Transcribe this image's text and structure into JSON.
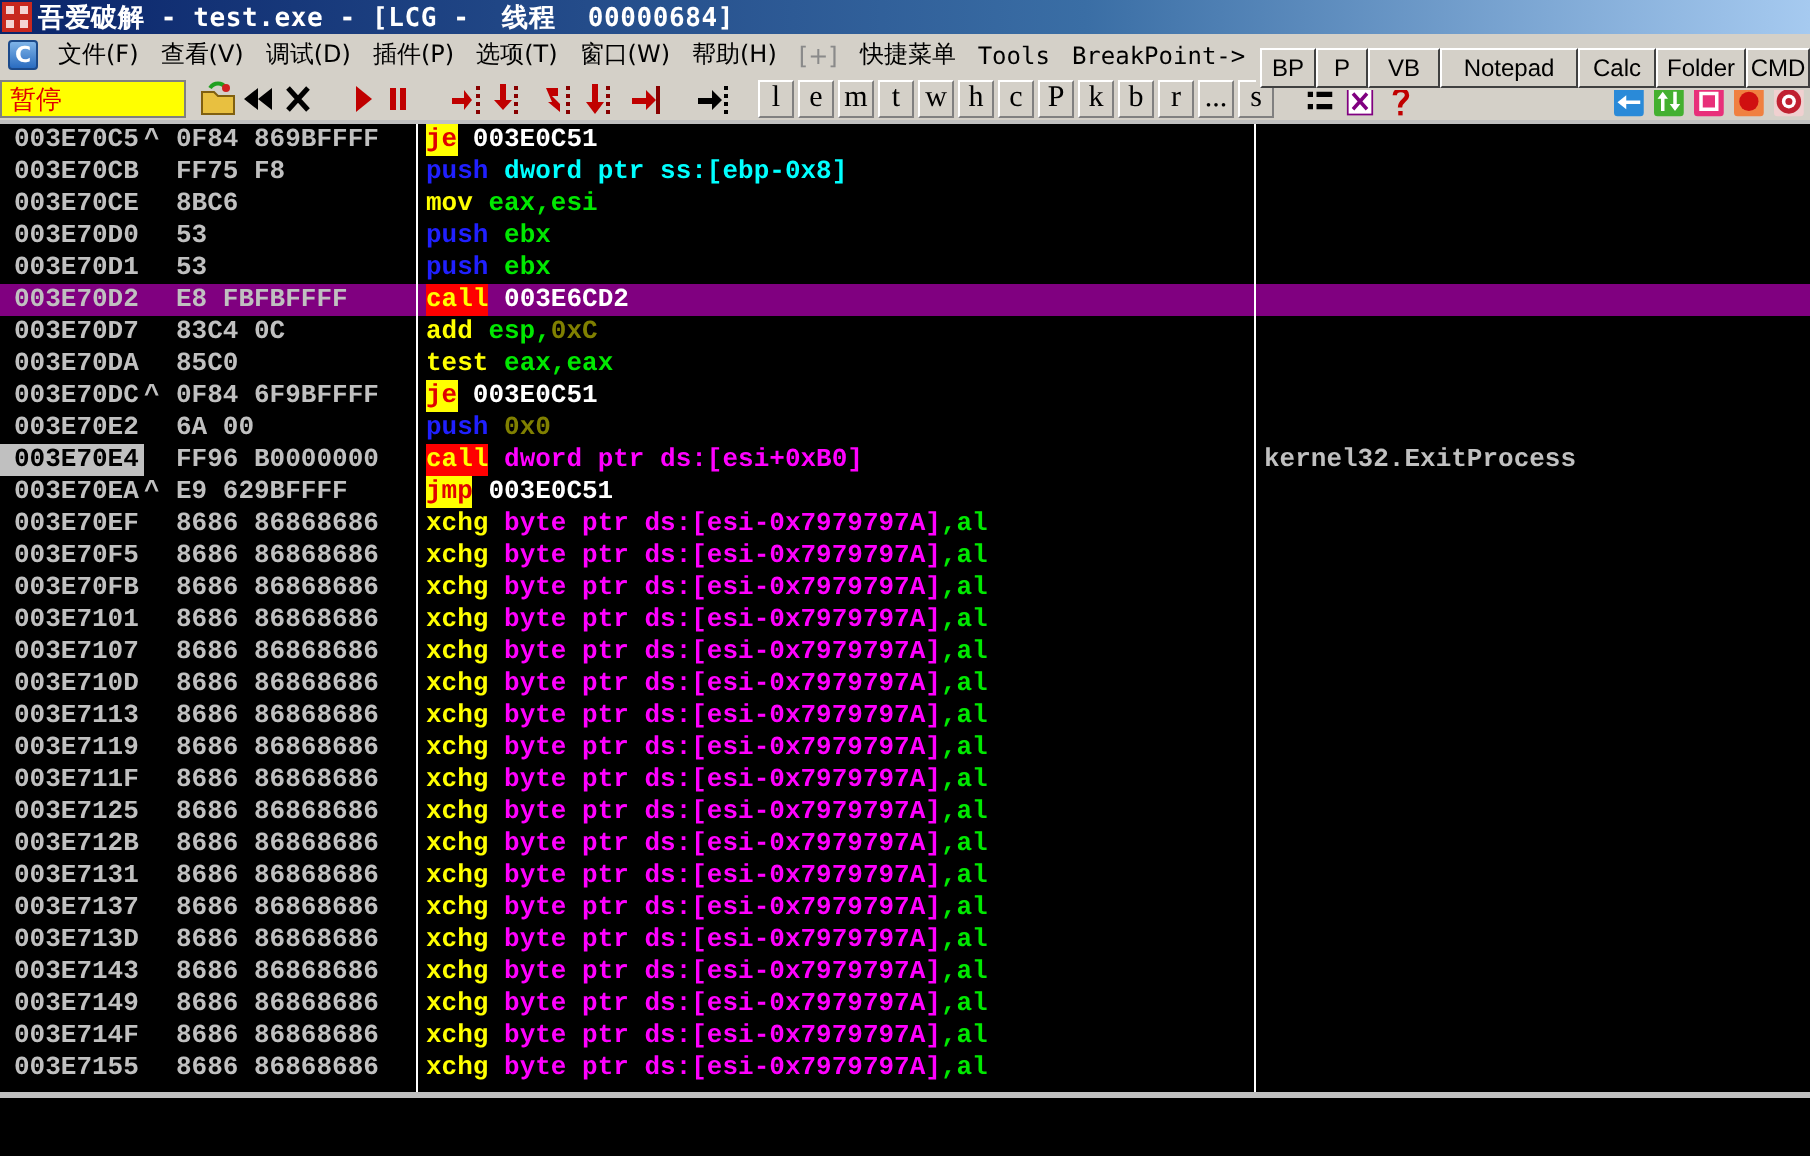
{
  "window": {
    "title": "吾爱破解 - test.exe - [LCG -  线程  00000684]"
  },
  "menubar": {
    "logo_letter": "C",
    "items": [
      {
        "label": "文件(F)",
        "disabled": false
      },
      {
        "label": "查看(V)",
        "disabled": false
      },
      {
        "label": "调试(D)",
        "disabled": false
      },
      {
        "label": "插件(P)",
        "disabled": false
      },
      {
        "label": "选项(T)",
        "disabled": false
      },
      {
        "label": "窗口(W)",
        "disabled": false
      },
      {
        "label": "帮助(H)",
        "disabled": false
      },
      {
        "label": "[+]",
        "disabled": true
      },
      {
        "label": "快捷菜单",
        "disabled": false
      },
      {
        "label": "Tools",
        "disabled": false
      },
      {
        "label": "BreakPoint->",
        "disabled": false
      }
    ]
  },
  "quick_buttons": [
    "BP",
    "P",
    "VB",
    "Notepad",
    "Calc",
    "Folder",
    "CMD"
  ],
  "toolbar": {
    "status": "暂停",
    "letter_buttons": [
      "l",
      "e",
      "m",
      "t",
      "w",
      "h",
      "c",
      "P",
      "k",
      "b",
      "r",
      "...",
      "s"
    ]
  },
  "disassembly": {
    "rows": [
      {
        "address": "003E70C5",
        "jump_mark": "^",
        "hex": "0F84 869BFFFF",
        "mnemonic": "je",
        "kind": "jump",
        "operands": [
          {
            "text": "003E0C51",
            "kind": "addr"
          }
        ],
        "selected": false,
        "current": false
      },
      {
        "address": "003E70CB",
        "hex": "FF75 F8",
        "mnemonic": "push",
        "kind": "push",
        "operands": [
          {
            "text": "dword ptr ss:[ebp-0x8]",
            "kind": "stack"
          }
        ],
        "selected": false,
        "current": false
      },
      {
        "address": "003E70CE",
        "hex": "8BC6",
        "mnemonic": "mov",
        "kind": "plain",
        "operands": [
          {
            "text": "eax,esi",
            "kind": "reg"
          }
        ],
        "selected": false,
        "current": false
      },
      {
        "address": "003E70D0",
        "hex": "53",
        "mnemonic": "push",
        "kind": "push",
        "operands": [
          {
            "text": "ebx",
            "kind": "reg"
          }
        ],
        "selected": false,
        "current": false
      },
      {
        "address": "003E70D1",
        "hex": "53",
        "mnemonic": "push",
        "kind": "push",
        "operands": [
          {
            "text": "ebx",
            "kind": "reg"
          }
        ],
        "selected": false,
        "current": false
      },
      {
        "address": "003E70D2",
        "hex": "E8 FBFBFFFF",
        "mnemonic": "call",
        "kind": "call",
        "operands": [
          {
            "text": "003E6CD2",
            "kind": "addr"
          }
        ],
        "selected": true,
        "current": false
      },
      {
        "address": "003E70D7",
        "hex": "83C4 0C",
        "mnemonic": "add",
        "kind": "plain",
        "operands": [
          {
            "text": "esp,",
            "kind": "reg"
          },
          {
            "text": "0xC",
            "kind": "const"
          }
        ],
        "selected": false,
        "current": false
      },
      {
        "address": "003E70DA",
        "hex": "85C0",
        "mnemonic": "test",
        "kind": "plain",
        "operands": [
          {
            "text": "eax,eax",
            "kind": "reg"
          }
        ],
        "selected": false,
        "current": false
      },
      {
        "address": "003E70DC",
        "jump_mark": "^",
        "hex": "0F84 6F9BFFFF",
        "mnemonic": "je",
        "kind": "jump",
        "operands": [
          {
            "text": "003E0C51",
            "kind": "addr"
          }
        ],
        "selected": false,
        "current": false
      },
      {
        "address": "003E70E2",
        "hex": "6A 00",
        "mnemonic": "push",
        "kind": "push",
        "operands": [
          {
            "text": "0x0",
            "kind": "const"
          }
        ],
        "selected": false,
        "current": false
      },
      {
        "address": "003E70E4",
        "hex": "FF96 B0000000",
        "mnemonic": "call",
        "kind": "call",
        "operands": [
          {
            "text": "dword ptr ds:[esi+0xB0]",
            "kind": "mem"
          }
        ],
        "comment": "kernel32.ExitProcess",
        "selected": false,
        "current": true
      },
      {
        "address": "003E70EA",
        "jump_mark": "^",
        "hex": "E9 629BFFFF",
        "mnemonic": "jmp",
        "kind": "jump",
        "operands": [
          {
            "text": "003E0C51",
            "kind": "addr"
          }
        ],
        "selected": false,
        "current": false
      },
      {
        "address": "003E70EF",
        "hex": "8686 86868686",
        "mnemonic": "xchg",
        "kind": "plain",
        "operands": [
          {
            "text": "byte ptr ds:[esi-0x7979797A]",
            "kind": "mem"
          },
          {
            "text": ",al",
            "kind": "reg"
          }
        ],
        "selected": false,
        "current": false
      },
      {
        "address": "003E70F5",
        "hex": "8686 86868686",
        "mnemonic": "xchg",
        "kind": "plain",
        "operands": [
          {
            "text": "byte ptr ds:[esi-0x7979797A]",
            "kind": "mem"
          },
          {
            "text": ",al",
            "kind": "reg"
          }
        ],
        "selected": false,
        "current": false
      },
      {
        "address": "003E70FB",
        "hex": "8686 86868686",
        "mnemonic": "xchg",
        "kind": "plain",
        "operands": [
          {
            "text": "byte ptr ds:[esi-0x7979797A]",
            "kind": "mem"
          },
          {
            "text": ",al",
            "kind": "reg"
          }
        ],
        "selected": false,
        "current": false
      },
      {
        "address": "003E7101",
        "hex": "8686 86868686",
        "mnemonic": "xchg",
        "kind": "plain",
        "operands": [
          {
            "text": "byte ptr ds:[esi-0x7979797A]",
            "kind": "mem"
          },
          {
            "text": ",al",
            "kind": "reg"
          }
        ],
        "selected": false,
        "current": false
      },
      {
        "address": "003E7107",
        "hex": "8686 86868686",
        "mnemonic": "xchg",
        "kind": "plain",
        "operands": [
          {
            "text": "byte ptr ds:[esi-0x7979797A]",
            "kind": "mem"
          },
          {
            "text": ",al",
            "kind": "reg"
          }
        ],
        "selected": false,
        "current": false
      },
      {
        "address": "003E710D",
        "hex": "8686 86868686",
        "mnemonic": "xchg",
        "kind": "plain",
        "operands": [
          {
            "text": "byte ptr ds:[esi-0x7979797A]",
            "kind": "mem"
          },
          {
            "text": ",al",
            "kind": "reg"
          }
        ],
        "selected": false,
        "current": false
      },
      {
        "address": "003E7113",
        "hex": "8686 86868686",
        "mnemonic": "xchg",
        "kind": "plain",
        "operands": [
          {
            "text": "byte ptr ds:[esi-0x7979797A]",
            "kind": "mem"
          },
          {
            "text": ",al",
            "kind": "reg"
          }
        ],
        "selected": false,
        "current": false
      },
      {
        "address": "003E7119",
        "hex": "8686 86868686",
        "mnemonic": "xchg",
        "kind": "plain",
        "operands": [
          {
            "text": "byte ptr ds:[esi-0x7979797A]",
            "kind": "mem"
          },
          {
            "text": ",al",
            "kind": "reg"
          }
        ],
        "selected": false,
        "current": false
      },
      {
        "address": "003E711F",
        "hex": "8686 86868686",
        "mnemonic": "xchg",
        "kind": "plain",
        "operands": [
          {
            "text": "byte ptr ds:[esi-0x7979797A]",
            "kind": "mem"
          },
          {
            "text": ",al",
            "kind": "reg"
          }
        ],
        "selected": false,
        "current": false
      },
      {
        "address": "003E7125",
        "hex": "8686 86868686",
        "mnemonic": "xchg",
        "kind": "plain",
        "operands": [
          {
            "text": "byte ptr ds:[esi-0x7979797A]",
            "kind": "mem"
          },
          {
            "text": ",al",
            "kind": "reg"
          }
        ],
        "selected": false,
        "current": false
      },
      {
        "address": "003E712B",
        "hex": "8686 86868686",
        "mnemonic": "xchg",
        "kind": "plain",
        "operands": [
          {
            "text": "byte ptr ds:[esi-0x7979797A]",
            "kind": "mem"
          },
          {
            "text": ",al",
            "kind": "reg"
          }
        ],
        "selected": false,
        "current": false
      },
      {
        "address": "003E7131",
        "hex": "8686 86868686",
        "mnemonic": "xchg",
        "kind": "plain",
        "operands": [
          {
            "text": "byte ptr ds:[esi-0x7979797A]",
            "kind": "mem"
          },
          {
            "text": ",al",
            "kind": "reg"
          }
        ],
        "selected": false,
        "current": false
      },
      {
        "address": "003E7137",
        "hex": "8686 86868686",
        "mnemonic": "xchg",
        "kind": "plain",
        "operands": [
          {
            "text": "byte ptr ds:[esi-0x7979797A]",
            "kind": "mem"
          },
          {
            "text": ",al",
            "kind": "reg"
          }
        ],
        "selected": false,
        "current": false
      },
      {
        "address": "003E713D",
        "hex": "8686 86868686",
        "mnemonic": "xchg",
        "kind": "plain",
        "operands": [
          {
            "text": "byte ptr ds:[esi-0x7979797A]",
            "kind": "mem"
          },
          {
            "text": ",al",
            "kind": "reg"
          }
        ],
        "selected": false,
        "current": false
      },
      {
        "address": "003E7143",
        "hex": "8686 86868686",
        "mnemonic": "xchg",
        "kind": "plain",
        "operands": [
          {
            "text": "byte ptr ds:[esi-0x7979797A]",
            "kind": "mem"
          },
          {
            "text": ",al",
            "kind": "reg"
          }
        ],
        "selected": false,
        "current": false
      },
      {
        "address": "003E7149",
        "hex": "8686 86868686",
        "mnemonic": "xchg",
        "kind": "plain",
        "operands": [
          {
            "text": "byte ptr ds:[esi-0x7979797A]",
            "kind": "mem"
          },
          {
            "text": ",al",
            "kind": "reg"
          }
        ],
        "selected": false,
        "current": false
      },
      {
        "address": "003E714F",
        "hex": "8686 86868686",
        "mnemonic": "xchg",
        "kind": "plain",
        "operands": [
          {
            "text": "byte ptr ds:[esi-0x7979797A]",
            "kind": "mem"
          },
          {
            "text": ",al",
            "kind": "reg"
          }
        ],
        "selected": false,
        "current": false
      },
      {
        "address": "003E7155",
        "hex": "8686 86868686",
        "mnemonic": "xchg",
        "kind": "plain",
        "operands": [
          {
            "text": "byte ptr ds:[esi-0x7979797A]",
            "kind": "mem"
          },
          {
            "text": ",al",
            "kind": "reg"
          }
        ],
        "selected": false,
        "current": false
      }
    ]
  }
}
